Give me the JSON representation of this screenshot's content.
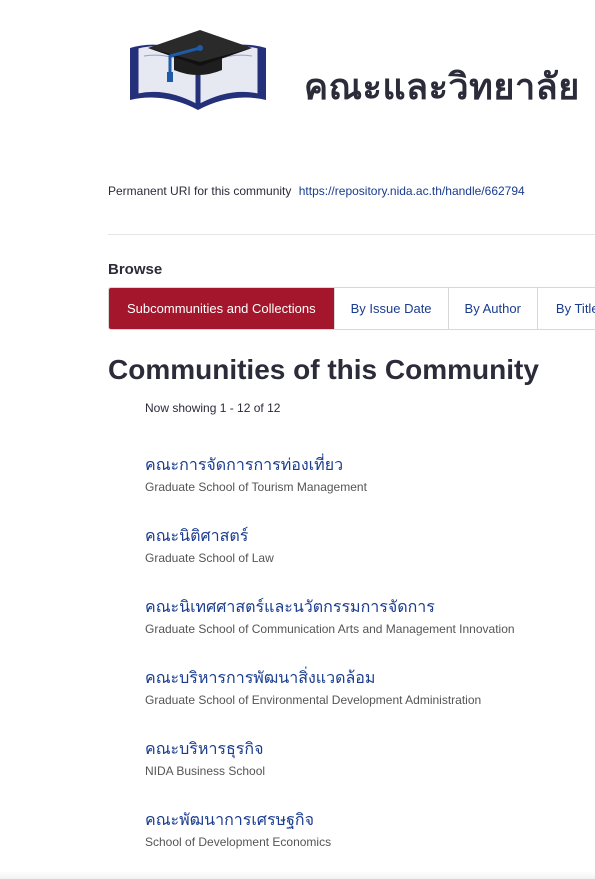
{
  "header": {
    "community_title": "คณะและวิทยาลัย",
    "logo_icon": "graduation-cap-book-icon",
    "colors": {
      "book_blue": "#24307a",
      "cap_dark": "#1e1e1e",
      "tassel_blue": "#1f5aa6"
    }
  },
  "uri": {
    "label": "Permanent URI for this community",
    "link": "https://repository.nida.ac.th/handle/662794"
  },
  "browse": {
    "heading": "Browse",
    "tabs": [
      {
        "label": "Subcommunities and Collections",
        "active": true
      },
      {
        "label": "By Issue Date",
        "active": false
      },
      {
        "label": "By Author",
        "active": false
      },
      {
        "label": "By Title",
        "active": false
      }
    ],
    "active_color": "#a3162b"
  },
  "main": {
    "section_title": "Communities of this Community",
    "showing": "Now showing 1 - 12 of 12",
    "communities": [
      {
        "thai": "คณะการจัดการการท่องเที่ยว",
        "english": "Graduate School of Tourism Management"
      },
      {
        "thai": "คณะนิติศาสตร์",
        "english": "Graduate School of Law"
      },
      {
        "thai": "คณะนิเทศศาสตร์และนวัตกรรมการจัดการ",
        "english": "Graduate School of Communication Arts and Management Innovation"
      },
      {
        "thai": "คณะบริหารการพัฒนาสิ่งแวดล้อม",
        "english": "Graduate School of Environmental Development Administration"
      },
      {
        "thai": "คณะบริหารธุรกิจ",
        "english": "NIDA Business School"
      },
      {
        "thai": "คณะพัฒนาการเศรษฐกิจ",
        "english": "School of Development Economics"
      }
    ]
  }
}
